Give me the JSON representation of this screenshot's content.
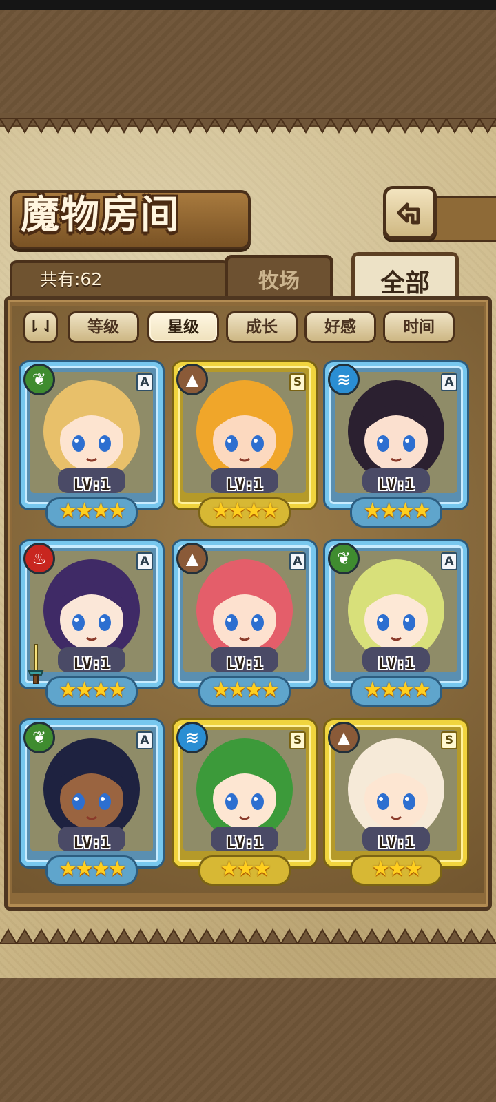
{
  "title": "魔物房间",
  "count_text": "共有:62",
  "tabs": {
    "ranch": "牧场",
    "all": "全部"
  },
  "sort": {
    "toggle": "⇂⇃",
    "buttons": [
      {
        "label": "等级",
        "active": false
      },
      {
        "label": "星级",
        "active": true
      },
      {
        "label": "成长",
        "active": false
      },
      {
        "label": "好感",
        "active": false
      },
      {
        "label": "时间",
        "active": false
      }
    ]
  },
  "monsters": [
    {
      "rank": "A",
      "element": "grass-icon",
      "level": "LV:1",
      "stars": "★★★★",
      "stars_count": 4,
      "frame": "blue",
      "hair": "#e8c06a",
      "skin": "#fde4d0"
    },
    {
      "rank": "S",
      "element": "earth-icon",
      "level": "LV:1",
      "stars": "★★★★",
      "stars_count": 4,
      "frame": "gold",
      "hair": "#f0a62a",
      "skin": "#fcd9bf"
    },
    {
      "rank": "A",
      "element": "water-icon",
      "level": "LV:1",
      "stars": "★★★★",
      "stars_count": 4,
      "frame": "blue",
      "hair": "#2b2030",
      "skin": "#fbe0cf"
    },
    {
      "rank": "A",
      "element": "fire-icon",
      "level": "LV:1",
      "stars": "★★★★",
      "stars_count": 4,
      "frame": "blue",
      "hair": "#3f2a66",
      "skin": "#fbe7d8"
    },
    {
      "rank": "A",
      "element": "earth-icon",
      "level": "LV:1",
      "stars": "★★★★",
      "stars_count": 4,
      "frame": "blue",
      "hair": "#e45e6a",
      "skin": "#fde1cf"
    },
    {
      "rank": "A",
      "element": "grass-icon",
      "level": "LV:1",
      "stars": "★★★★",
      "stars_count": 4,
      "frame": "blue",
      "hair": "#d8e07a",
      "skin": "#fde8d6"
    },
    {
      "rank": "A",
      "element": "grass-icon",
      "level": "LV:1",
      "stars": "★★★★",
      "stars_count": 4,
      "frame": "blue",
      "hair": "#1e2240",
      "skin": "#9a6440"
    },
    {
      "rank": "S",
      "element": "water-icon",
      "level": "LV:1",
      "stars": "★★★",
      "stars_count": 3,
      "frame": "gold",
      "hair": "#3c9a3a",
      "skin": "#fde6d2"
    },
    {
      "rank": "S",
      "element": "earth-icon",
      "level": "LV:1",
      "stars": "★★★",
      "stars_count": 3,
      "frame": "gold",
      "hair": "#f6ead8",
      "skin": "#fde6d2"
    }
  ]
}
